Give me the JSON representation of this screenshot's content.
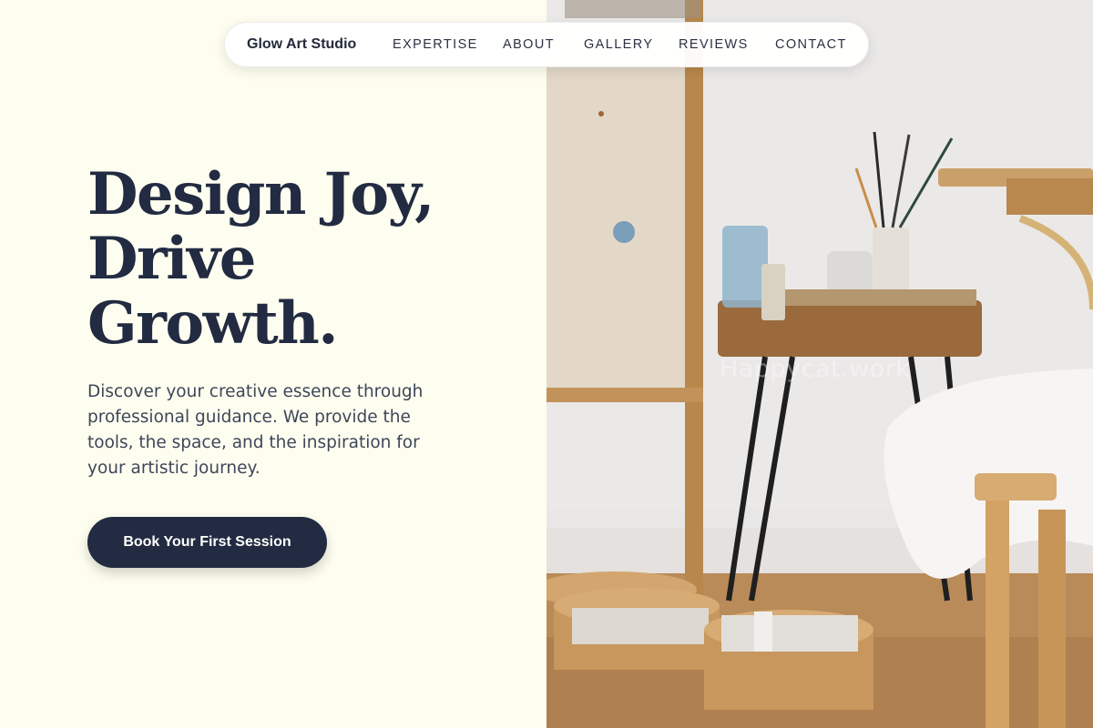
{
  "nav": {
    "brand": "Glow Art Studio",
    "links": [
      "EXPERTISE",
      "ABOUT",
      "GALLERY",
      "REVIEWS",
      "CONTACT"
    ]
  },
  "hero": {
    "headline_line1": "Design Joy,",
    "headline_line2": "Drive",
    "headline_line3": "Growth.",
    "subtext": "Discover your creative essence through professional guidance. We provide the tools, the space, and the inspiration for your artistic journey.",
    "cta_label": "Book Your First Session"
  },
  "image": {
    "watermark": "Happycat.work"
  },
  "colors": {
    "background": "#fefef0",
    "primary_dark": "#222b41"
  }
}
